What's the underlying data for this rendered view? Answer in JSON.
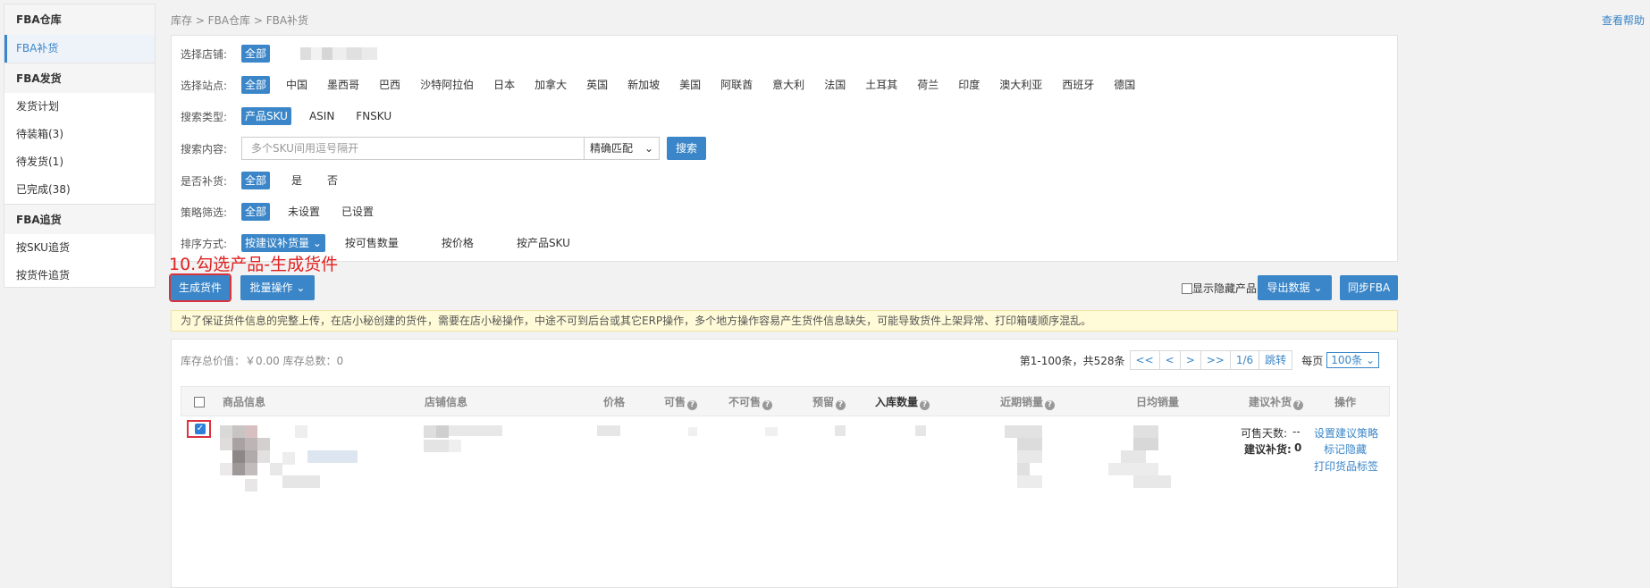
{
  "sidebar": {
    "groups": [
      {
        "title": "FBA仓库",
        "items": [
          {
            "label": "FBA补货",
            "active": true
          }
        ]
      },
      {
        "title": "FBA发货",
        "items": [
          {
            "label": "发货计划"
          },
          {
            "label": "待装箱(3)"
          },
          {
            "label": "待发货(1)"
          },
          {
            "label": "已完成(38)"
          }
        ]
      },
      {
        "title": "FBA追货",
        "items": [
          {
            "label": "按SKU追货"
          },
          {
            "label": "按货件追货"
          }
        ]
      }
    ]
  },
  "breadcrumb": "库存 > FBA仓库 > FBA补货",
  "help_link": "查看帮助",
  "filters": {
    "store": {
      "label": "选择店铺:",
      "selected": "全部"
    },
    "site": {
      "label": "选择站点:",
      "options": [
        "全部",
        "中国",
        "墨西哥",
        "巴西",
        "沙特阿拉伯",
        "日本",
        "加拿大",
        "英国",
        "新加坡",
        "美国",
        "阿联酋",
        "意大利",
        "法国",
        "土耳其",
        "荷兰",
        "印度",
        "澳大利亚",
        "西班牙",
        "德国"
      ]
    },
    "search_type": {
      "label": "搜索类型:",
      "options": [
        "产品SKU",
        "ASIN",
        "FNSKU"
      ]
    },
    "search_content": {
      "label": "搜索内容:",
      "placeholder": "多个SKU间用逗号隔开",
      "match": "精确匹配",
      "button": "搜索"
    },
    "replenish": {
      "label": "是否补货:",
      "options": [
        "全部",
        "是",
        "否"
      ]
    },
    "strategy": {
      "label": "策略筛选:",
      "options": [
        "全部",
        "未设置",
        "已设置"
      ]
    },
    "sort": {
      "label": "排序方式:",
      "options": [
        "按建议补货量",
        "按可售数量",
        "按价格",
        "按产品SKU"
      ]
    }
  },
  "annotation": "10.勾选产品-生成货件",
  "actions": {
    "generate": "生成货件",
    "batch": "批量操作",
    "show_hidden": "显示隐藏产品",
    "export": "导出数据",
    "sync": "同步FBA"
  },
  "notice": "为了保证货件信息的完整上传，在店小秘创建的货件，需要在店小秘操作，中途不可到后台或其它ERP操作，多个地方操作容易产生货件信息缺失，可能导致货件上架异常、打印箱唛顺序混乱。",
  "summary": "库存总价值：￥0.00 库存总数：0",
  "pager": {
    "range": "第1-100条，共528条",
    "first": "<<",
    "prev": "<",
    "next": ">",
    "last": ">>",
    "page": "1/6",
    "jump": "跳转",
    "per_label": "每页",
    "per_value": "100条"
  },
  "table": {
    "headers": [
      "商品信息",
      "店铺信息",
      "价格",
      "可售",
      "不可售",
      "预留",
      "入库数量",
      "近期销量",
      "日均销量",
      "建议补货",
      "操作"
    ],
    "row": {
      "sell_days_label": "可售天数:",
      "sell_days_value": "--",
      "suggest_label": "建议补货:",
      "suggest_value": "0",
      "ops": [
        "设置建议策略",
        "标记隐藏",
        "打印货品标签"
      ]
    }
  },
  "colors": {
    "primary": "#3a86c8",
    "annotation": "#e02020",
    "notice_bg": "#fffbd8"
  }
}
